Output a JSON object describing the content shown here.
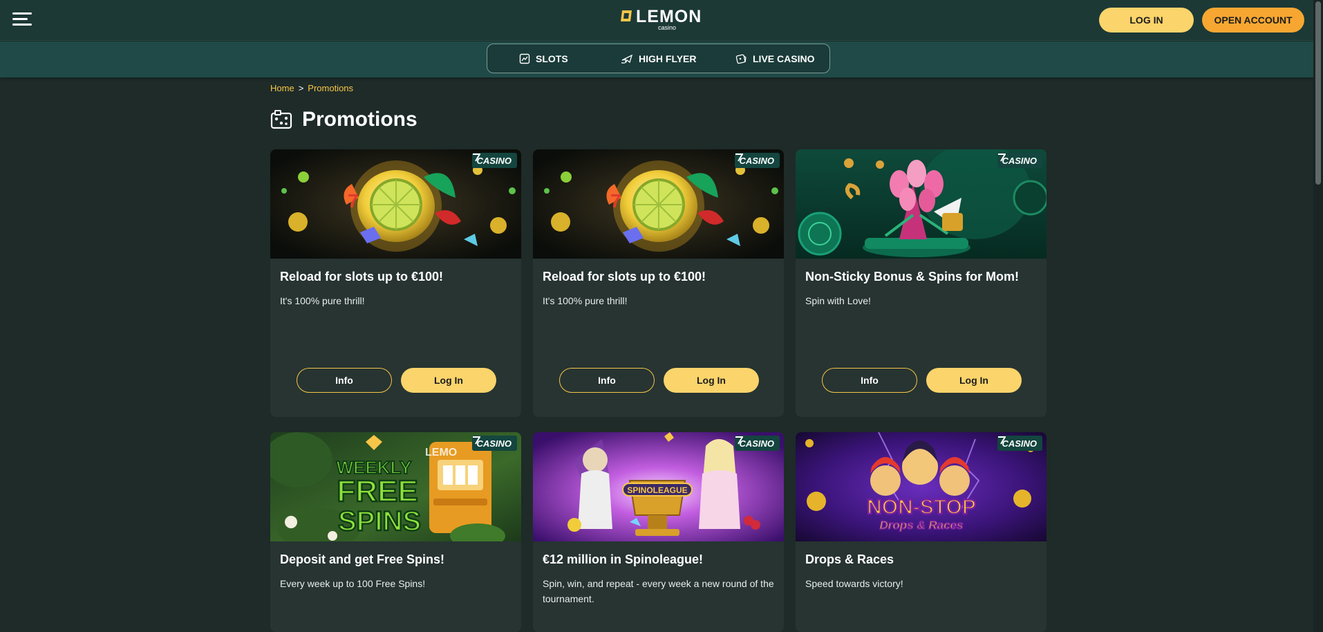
{
  "header": {
    "logo_text": "LEMON",
    "logo_sub": "casino",
    "login_label": "LOG IN",
    "open_account_label": "OPEN ACCOUNT"
  },
  "nav": {
    "items": [
      {
        "label": "SLOTS",
        "icon": "slots-icon"
      },
      {
        "label": "HIGH FLYER",
        "icon": "plane-icon"
      },
      {
        "label": "LIVE CASINO",
        "icon": "live-casino-icon"
      }
    ]
  },
  "breadcrumb": {
    "home": "Home",
    "separator": ">",
    "current": "Promotions"
  },
  "page": {
    "title": "Promotions",
    "title_icon": "promotions-icon"
  },
  "colors": {
    "accent_yellow": "#fbd46b",
    "accent_orange": "#f7a731",
    "breadcrumb": "#f7c548",
    "background": "#1e2b28",
    "card": "#273431"
  },
  "cards": [
    {
      "badge": "CASINO",
      "title": "Reload for slots up to €100!",
      "desc": "It's 100% pure thrill!",
      "info_label": "Info",
      "login_label": "Log In",
      "art": "lemon-slot"
    },
    {
      "badge": "CASINO",
      "title": "Reload for slots up to €100!",
      "desc": "It's 100% pure thrill!",
      "info_label": "Info",
      "login_label": "Log In",
      "art": "lemon-slot"
    },
    {
      "badge": "CASINO",
      "title": "Non-Sticky Bonus & Spins for Mom!",
      "desc": "Spin with Love!",
      "info_label": "Info",
      "login_label": "Log In",
      "art": "tulips"
    },
    {
      "badge": "CASINO",
      "title": "Deposit and get Free Spins!",
      "desc": "Every week up to 100 Free Spins!",
      "art": "weekly-free-spins",
      "art_text": [
        "WEEKLY",
        "FREE",
        "SPINS"
      ]
    },
    {
      "badge": "CASINO",
      "title": "€12 million in Spinoleague!",
      "desc": "Spin, win, and repeat - every week a new round of the tournament.",
      "art": "spinoleague",
      "art_text": [
        "SPINOLEAGUE"
      ]
    },
    {
      "badge": "CASINO",
      "title": "Drops & Races",
      "desc": "Speed towards victory!",
      "art": "drops-races",
      "art_text": [
        "NON-STOP",
        "Drops & Races"
      ]
    }
  ]
}
